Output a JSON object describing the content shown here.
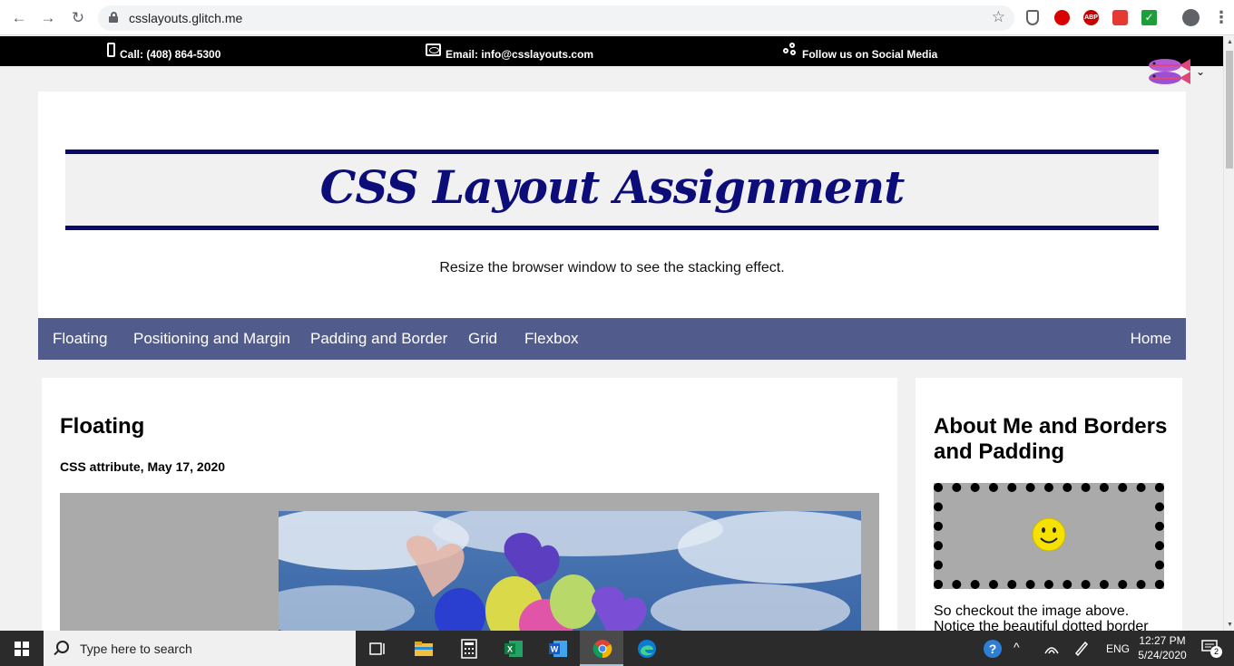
{
  "browser": {
    "url": "csslayouts.glitch.me",
    "back_glyph": "←",
    "forward_glyph": "→",
    "reload_glyph": "↻",
    "star_glyph": "☆",
    "menu_glyph": "⋮",
    "extensions": [
      "shield-icon",
      "opera-icon",
      "adblock-plus-icon",
      "honey-icon",
      "checkmark-icon",
      "profile-icon"
    ],
    "ext_abp_label": "ABP"
  },
  "topbar": {
    "phone": "Call: (408) 864-5300",
    "email": "Email: info@csslayouts.com",
    "social": "Follow us on Social Media"
  },
  "header": {
    "title": "CSS Layout Assignment",
    "tagline": "Resize the browser window to see the stacking effect."
  },
  "nav": {
    "items": [
      "Floating",
      "Positioning and Margin",
      "Padding and Border",
      "Grid",
      "Flexbox"
    ],
    "home": "Home"
  },
  "main": {
    "post_title": "Floating",
    "post_meta": "CSS attribute, May 17, 2020"
  },
  "sidebar": {
    "title": "About Me and Borders and Padding",
    "text": "So checkout the image above. Notice the beautiful dotted border"
  },
  "taskbar": {
    "search_placeholder": "Type here to search",
    "language": "ENG",
    "time": "12:27 PM",
    "date": "5/24/2020",
    "notifications": "2"
  },
  "colors": {
    "topbar": "#000000",
    "title_border": "#0a0a6b",
    "title_text": "#0d0d7a",
    "nav_bg": "#515c8c",
    "page_bg": "#f1f1f1",
    "placeholder_gray": "#aaaaaa"
  }
}
